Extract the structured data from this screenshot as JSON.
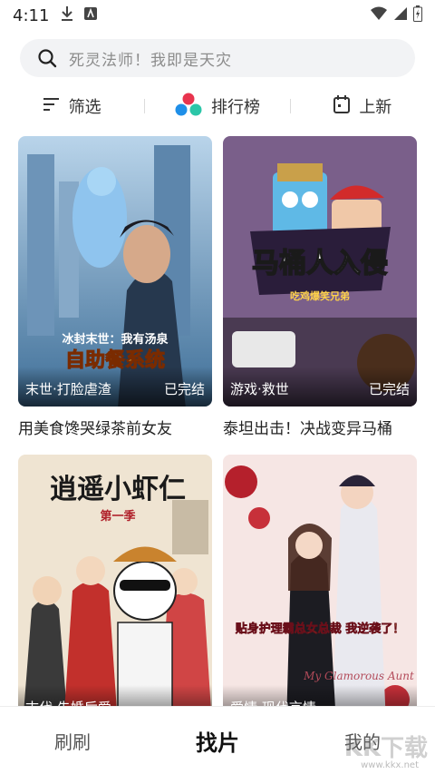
{
  "status_bar": {
    "time": "4:11"
  },
  "search": {
    "placeholder": "死灵法师！我即是天灾"
  },
  "filters": [
    {
      "label": "筛选"
    },
    {
      "label": "排行榜"
    },
    {
      "label": "上新"
    }
  ],
  "comics": [
    {
      "tag": "末世·打脸虐渣",
      "status": "已完结",
      "title": "用美食馋哭绿茶前女友",
      "cover_text": "冰封末世：我有汤泉",
      "cover_title": "自助餐系统"
    },
    {
      "tag": "游戏·救世",
      "status": "已完结",
      "title": "泰坦出击！决战变异马桶",
      "cover_title": "马桶人入侵",
      "cover_subtitle": "吃鸡爆笑兄弟"
    },
    {
      "tag": "古代·先婚后爱",
      "status": "",
      "title": "",
      "cover_title": "逍遥小虾仁",
      "cover_subtitle": "第一季"
    },
    {
      "tag": "爱情·现代言情",
      "status": "",
      "title": "",
      "cover_title": "贴身护理霸总女总裁 我逆袭了！",
      "cover_subtitle": "My Glamorous Aunt"
    }
  ],
  "bottom_nav": [
    {
      "label": "刷刷"
    },
    {
      "label": "找片"
    },
    {
      "label": "我的"
    }
  ],
  "watermark": {
    "text": "KK下载",
    "url": "www.kkx.net"
  },
  "colors": {
    "accent_red": "#e8344e",
    "accent_blue": "#1f8fe8",
    "accent_teal": "#2bc6a8"
  }
}
